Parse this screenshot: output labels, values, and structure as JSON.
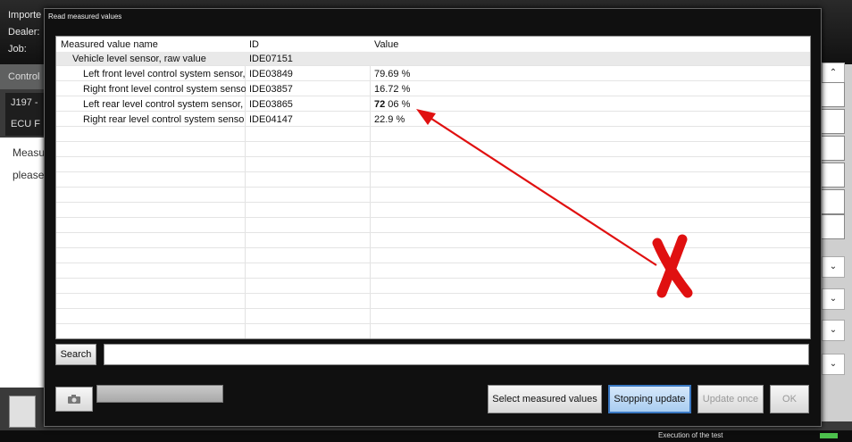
{
  "background": {
    "labels": [
      "Importe",
      "Dealer:",
      "Job:"
    ],
    "grey_bar_label": "Control",
    "side_rows": [
      "J197 -",
      "ECU F"
    ],
    "side_text": [
      "Measu",
      "please"
    ],
    "status_text": "Execution of the test"
  },
  "dialog": {
    "title": "Read measured values",
    "columns": [
      "Measured value name",
      "ID",
      "Value"
    ],
    "rows": [
      {
        "name": "Vehicle level sensor, raw value",
        "id": "IDE07151",
        "value": "",
        "group": true
      },
      {
        "name": "Left front level control system sensor,",
        "id": "IDE03849",
        "value": "79.69 %"
      },
      {
        "name": "Right front level control system senso",
        "id": "IDE03857",
        "value": "16.72 %"
      },
      {
        "name": "Left rear level control system sensor,",
        "id": "IDE03865",
        "value_bold": "72",
        "value_rest": " 06 %"
      },
      {
        "name": "Right rear level control system senso",
        "id": "IDE04147",
        "value": "22.9 %"
      }
    ],
    "search_label": "Search",
    "search_value": "",
    "buttons": {
      "select": "Select measured values",
      "stop": "Stopping update",
      "update_once": "Update once",
      "ok": "OK"
    },
    "camera_icon": "camera-icon"
  },
  "colors": {
    "annotation": "#e01010",
    "accent_button": "#3a78c2"
  }
}
